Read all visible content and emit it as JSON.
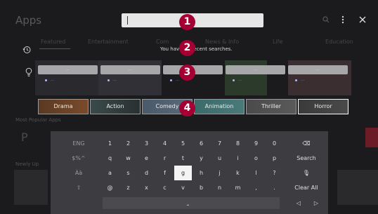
{
  "background": {
    "app_title": "Apps",
    "tabs": [
      "Featured",
      "Entertainment",
      "Com",
      "News & Info",
      "Life",
      "Education"
    ],
    "section_most_popular": "Most Popular Apps",
    "section_newly_updated": "Newly Up"
  },
  "search": {
    "value": "",
    "placeholder": ""
  },
  "recent_searches": {
    "message": "You have no recent searches."
  },
  "suggestions": [
    {
      "title": "…",
      "sub": "…"
    },
    {
      "title": "…",
      "sub": "…"
    },
    {
      "title": "…",
      "sub": "…"
    },
    {
      "title": "…",
      "sub": "…"
    },
    {
      "title": "…",
      "sub": "…"
    }
  ],
  "genres": [
    "Drama",
    "Action",
    "Comedy",
    "Animation",
    "Thriller",
    "Horror"
  ],
  "markers": [
    "1",
    "2",
    "3",
    "4"
  ],
  "keyboard": {
    "rows": [
      [
        "ENG",
        "1",
        "2",
        "3",
        "4",
        "5",
        "6",
        "7",
        "8",
        "9",
        "0",
        "⌫"
      ],
      [
        "$%^",
        "q",
        "w",
        "e",
        "r",
        "t",
        "y",
        "u",
        "i",
        "o",
        "p",
        "Search"
      ],
      [
        "Àà",
        "a",
        "s",
        "d",
        "f",
        "g",
        "h",
        "j",
        "k",
        "l",
        "?",
        "🎙"
      ],
      [
        "⇧",
        "@",
        "z",
        "x",
        "c",
        "v",
        "b",
        "n",
        "m",
        ",",
        ".",
        "Clear All"
      ]
    ],
    "focused_key": "g",
    "space_symbol": "⎵",
    "left_arrow": "◁",
    "right_arrow": "▷"
  },
  "colors": {
    "marker": "#a50034",
    "background": "#1b1b1d",
    "keyboard": "#3d3d41"
  },
  "icons": [
    "history-icon",
    "lightbulb-icon",
    "search-icon",
    "more-icon",
    "close-icon",
    "backspace-icon",
    "microphone-icon",
    "shift-icon"
  ]
}
